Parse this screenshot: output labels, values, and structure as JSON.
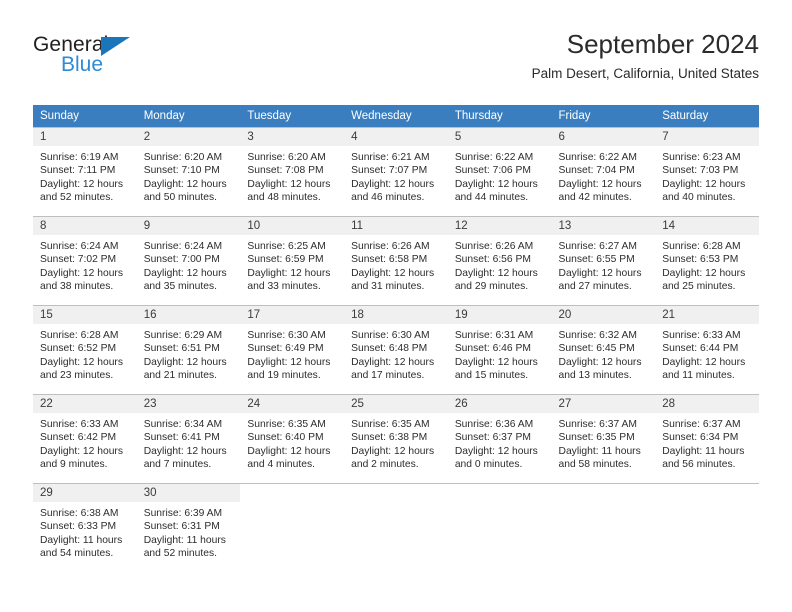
{
  "brand": {
    "name_dark": "General",
    "name_light": "Blue",
    "accent_color": "#1b75bb",
    "light_color": "#2e8bd6"
  },
  "header": {
    "title": "September 2024",
    "subtitle": "Palm Desert, California, United States",
    "header_bg_color": "#3a7ebf",
    "daynum_bg_color": "#f0f0f0"
  },
  "weekdays": [
    "Sunday",
    "Monday",
    "Tuesday",
    "Wednesday",
    "Thursday",
    "Friday",
    "Saturday"
  ],
  "labels": {
    "sunrise_prefix": "Sunrise:",
    "sunset_prefix": "Sunset:",
    "daylight_prefix": "Daylight:"
  },
  "weeks": [
    [
      {
        "day": "1",
        "sunrise": "Sunrise: 6:19 AM",
        "sunset": "Sunset: 7:11 PM",
        "daylight_l1": "Daylight: 12 hours",
        "daylight_l2": "and 52 minutes."
      },
      {
        "day": "2",
        "sunrise": "Sunrise: 6:20 AM",
        "sunset": "Sunset: 7:10 PM",
        "daylight_l1": "Daylight: 12 hours",
        "daylight_l2": "and 50 minutes."
      },
      {
        "day": "3",
        "sunrise": "Sunrise: 6:20 AM",
        "sunset": "Sunset: 7:08 PM",
        "daylight_l1": "Daylight: 12 hours",
        "daylight_l2": "and 48 minutes."
      },
      {
        "day": "4",
        "sunrise": "Sunrise: 6:21 AM",
        "sunset": "Sunset: 7:07 PM",
        "daylight_l1": "Daylight: 12 hours",
        "daylight_l2": "and 46 minutes."
      },
      {
        "day": "5",
        "sunrise": "Sunrise: 6:22 AM",
        "sunset": "Sunset: 7:06 PM",
        "daylight_l1": "Daylight: 12 hours",
        "daylight_l2": "and 44 minutes."
      },
      {
        "day": "6",
        "sunrise": "Sunrise: 6:22 AM",
        "sunset": "Sunset: 7:04 PM",
        "daylight_l1": "Daylight: 12 hours",
        "daylight_l2": "and 42 minutes."
      },
      {
        "day": "7",
        "sunrise": "Sunrise: 6:23 AM",
        "sunset": "Sunset: 7:03 PM",
        "daylight_l1": "Daylight: 12 hours",
        "daylight_l2": "and 40 minutes."
      }
    ],
    [
      {
        "day": "8",
        "sunrise": "Sunrise: 6:24 AM",
        "sunset": "Sunset: 7:02 PM",
        "daylight_l1": "Daylight: 12 hours",
        "daylight_l2": "and 38 minutes."
      },
      {
        "day": "9",
        "sunrise": "Sunrise: 6:24 AM",
        "sunset": "Sunset: 7:00 PM",
        "daylight_l1": "Daylight: 12 hours",
        "daylight_l2": "and 35 minutes."
      },
      {
        "day": "10",
        "sunrise": "Sunrise: 6:25 AM",
        "sunset": "Sunset: 6:59 PM",
        "daylight_l1": "Daylight: 12 hours",
        "daylight_l2": "and 33 minutes."
      },
      {
        "day": "11",
        "sunrise": "Sunrise: 6:26 AM",
        "sunset": "Sunset: 6:58 PM",
        "daylight_l1": "Daylight: 12 hours",
        "daylight_l2": "and 31 minutes."
      },
      {
        "day": "12",
        "sunrise": "Sunrise: 6:26 AM",
        "sunset": "Sunset: 6:56 PM",
        "daylight_l1": "Daylight: 12 hours",
        "daylight_l2": "and 29 minutes."
      },
      {
        "day": "13",
        "sunrise": "Sunrise: 6:27 AM",
        "sunset": "Sunset: 6:55 PM",
        "daylight_l1": "Daylight: 12 hours",
        "daylight_l2": "and 27 minutes."
      },
      {
        "day": "14",
        "sunrise": "Sunrise: 6:28 AM",
        "sunset": "Sunset: 6:53 PM",
        "daylight_l1": "Daylight: 12 hours",
        "daylight_l2": "and 25 minutes."
      }
    ],
    [
      {
        "day": "15",
        "sunrise": "Sunrise: 6:28 AM",
        "sunset": "Sunset: 6:52 PM",
        "daylight_l1": "Daylight: 12 hours",
        "daylight_l2": "and 23 minutes."
      },
      {
        "day": "16",
        "sunrise": "Sunrise: 6:29 AM",
        "sunset": "Sunset: 6:51 PM",
        "daylight_l1": "Daylight: 12 hours",
        "daylight_l2": "and 21 minutes."
      },
      {
        "day": "17",
        "sunrise": "Sunrise: 6:30 AM",
        "sunset": "Sunset: 6:49 PM",
        "daylight_l1": "Daylight: 12 hours",
        "daylight_l2": "and 19 minutes."
      },
      {
        "day": "18",
        "sunrise": "Sunrise: 6:30 AM",
        "sunset": "Sunset: 6:48 PM",
        "daylight_l1": "Daylight: 12 hours",
        "daylight_l2": "and 17 minutes."
      },
      {
        "day": "19",
        "sunrise": "Sunrise: 6:31 AM",
        "sunset": "Sunset: 6:46 PM",
        "daylight_l1": "Daylight: 12 hours",
        "daylight_l2": "and 15 minutes."
      },
      {
        "day": "20",
        "sunrise": "Sunrise: 6:32 AM",
        "sunset": "Sunset: 6:45 PM",
        "daylight_l1": "Daylight: 12 hours",
        "daylight_l2": "and 13 minutes."
      },
      {
        "day": "21",
        "sunrise": "Sunrise: 6:33 AM",
        "sunset": "Sunset: 6:44 PM",
        "daylight_l1": "Daylight: 12 hours",
        "daylight_l2": "and 11 minutes."
      }
    ],
    [
      {
        "day": "22",
        "sunrise": "Sunrise: 6:33 AM",
        "sunset": "Sunset: 6:42 PM",
        "daylight_l1": "Daylight: 12 hours",
        "daylight_l2": "and 9 minutes."
      },
      {
        "day": "23",
        "sunrise": "Sunrise: 6:34 AM",
        "sunset": "Sunset: 6:41 PM",
        "daylight_l1": "Daylight: 12 hours",
        "daylight_l2": "and 7 minutes."
      },
      {
        "day": "24",
        "sunrise": "Sunrise: 6:35 AM",
        "sunset": "Sunset: 6:40 PM",
        "daylight_l1": "Daylight: 12 hours",
        "daylight_l2": "and 4 minutes."
      },
      {
        "day": "25",
        "sunrise": "Sunrise: 6:35 AM",
        "sunset": "Sunset: 6:38 PM",
        "daylight_l1": "Daylight: 12 hours",
        "daylight_l2": "and 2 minutes."
      },
      {
        "day": "26",
        "sunrise": "Sunrise: 6:36 AM",
        "sunset": "Sunset: 6:37 PM",
        "daylight_l1": "Daylight: 12 hours",
        "daylight_l2": "and 0 minutes."
      },
      {
        "day": "27",
        "sunrise": "Sunrise: 6:37 AM",
        "sunset": "Sunset: 6:35 PM",
        "daylight_l1": "Daylight: 11 hours",
        "daylight_l2": "and 58 minutes."
      },
      {
        "day": "28",
        "sunrise": "Sunrise: 6:37 AM",
        "sunset": "Sunset: 6:34 PM",
        "daylight_l1": "Daylight: 11 hours",
        "daylight_l2": "and 56 minutes."
      }
    ],
    [
      {
        "day": "29",
        "sunrise": "Sunrise: 6:38 AM",
        "sunset": "Sunset: 6:33 PM",
        "daylight_l1": "Daylight: 11 hours",
        "daylight_l2": "and 54 minutes."
      },
      {
        "day": "30",
        "sunrise": "Sunrise: 6:39 AM",
        "sunset": "Sunset: 6:31 PM",
        "daylight_l1": "Daylight: 11 hours",
        "daylight_l2": "and 52 minutes."
      },
      {
        "day": "",
        "sunrise": "",
        "sunset": "",
        "daylight_l1": "",
        "daylight_l2": ""
      },
      {
        "day": "",
        "sunrise": "",
        "sunset": "",
        "daylight_l1": "",
        "daylight_l2": ""
      },
      {
        "day": "",
        "sunrise": "",
        "sunset": "",
        "daylight_l1": "",
        "daylight_l2": ""
      },
      {
        "day": "",
        "sunrise": "",
        "sunset": "",
        "daylight_l1": "",
        "daylight_l2": ""
      },
      {
        "day": "",
        "sunrise": "",
        "sunset": "",
        "daylight_l1": "",
        "daylight_l2": ""
      }
    ]
  ]
}
